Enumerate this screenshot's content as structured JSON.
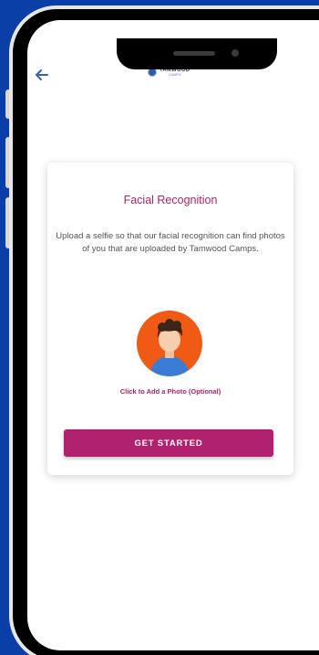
{
  "header": {
    "back_icon": "arrow-left-icon",
    "logo": {
      "name": "TAMWOOD",
      "sub": "CAMPS"
    }
  },
  "card": {
    "title": "Facial Recognition",
    "description": "Upload a selfie so that our facial recognition can find photos of you that are uploaded by Tamwood Camps.",
    "avatar_icon": "person-avatar-icon",
    "add_photo_label": "Click to Add a Photo (Optional)",
    "cta_label": "GET STARTED"
  },
  "colors": {
    "background": "#0a3fa8",
    "accent": "#b0226e",
    "avatar_bg": "#f05a14",
    "back_arrow": "#3b5fb0"
  }
}
